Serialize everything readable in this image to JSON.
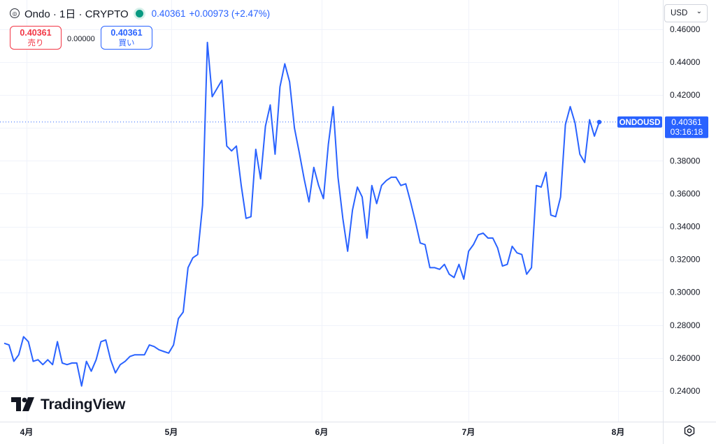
{
  "header": {
    "title": "Ondo · 1日 · CRYPTO",
    "price": "0.40361",
    "change": "+0.00973 (+2.47%)",
    "logo_icon": "ondo-logo-icon",
    "status_icon": "market-status-dot-icon"
  },
  "trade": {
    "sell_price": "0.40361",
    "sell_label": "売り",
    "spread": "0.00000",
    "buy_price": "0.40361",
    "buy_label": "買い"
  },
  "currency": {
    "label": "USD",
    "icon": "chevron-down-icon"
  },
  "watermark": {
    "text": "TradingView",
    "icon": "tradingview-logo-icon"
  },
  "price_label": {
    "symbol": "ONDOUSD",
    "price": "0.40361",
    "countdown": "03:16:18"
  },
  "settings": {
    "icon": "settings-icon"
  },
  "colors": {
    "line": "#2962ff",
    "sell": "#f23645",
    "buy": "#2962ff",
    "status": "#089981",
    "grid": "#f0f3fa"
  },
  "chart_data": {
    "type": "line",
    "series": [
      {
        "values": [
          0.269,
          0.268,
          0.258,
          0.262,
          0.273,
          0.27,
          0.258,
          0.259,
          0.256,
          0.259,
          0.256,
          0.27,
          0.257,
          0.256,
          0.257,
          0.257,
          0.243,
          0.258,
          0.252,
          0.259,
          0.27,
          0.271,
          0.259,
          0.251,
          0.256,
          0.258,
          0.261,
          0.262,
          0.262,
          0.262,
          0.268,
          0.267,
          0.265,
          0.264,
          0.263,
          0.268,
          0.284,
          0.288,
          0.315,
          0.321,
          0.323,
          0.353,
          0.452,
          0.419,
          0.424,
          0.429,
          0.389,
          0.386,
          0.389,
          0.365,
          0.345,
          0.346,
          0.387,
          0.369,
          0.401,
          0.414,
          0.384,
          0.425,
          0.439,
          0.428,
          0.4,
          0.385,
          0.369,
          0.355,
          0.376,
          0.365,
          0.357,
          0.39,
          0.413,
          0.37,
          0.345,
          0.325,
          0.35,
          0.364,
          0.358,
          0.333,
          0.365,
          0.354,
          0.365,
          0.368,
          0.37,
          0.37,
          0.365,
          0.366,
          0.355,
          0.343,
          0.33,
          0.329,
          0.315,
          0.315,
          0.314,
          0.317,
          0.311,
          0.309,
          0.317,
          0.308,
          0.325,
          0.329,
          0.335,
          0.336,
          0.333,
          0.333,
          0.327,
          0.316,
          0.317,
          0.328,
          0.324,
          0.323,
          0.311,
          0.315,
          0.365,
          0.364,
          0.373,
          0.347,
          0.346,
          0.358,
          0.402,
          0.413,
          0.403,
          0.384,
          0.379,
          0.405,
          0.395,
          0.4036
        ]
      }
    ],
    "y_ticks": [
      "0.46000",
      "0.44000",
      "0.42000",
      "0.40000",
      "0.38000",
      "0.36000",
      "0.34000",
      "0.32000",
      "0.30000",
      "0.28000",
      "0.26000",
      "0.24000"
    ],
    "x_ticks": [
      "4月",
      "5月",
      "6月",
      "7月",
      "8月"
    ],
    "last_value": 0.40361,
    "ylim": [
      0.235,
      0.47
    ],
    "grid": true
  }
}
